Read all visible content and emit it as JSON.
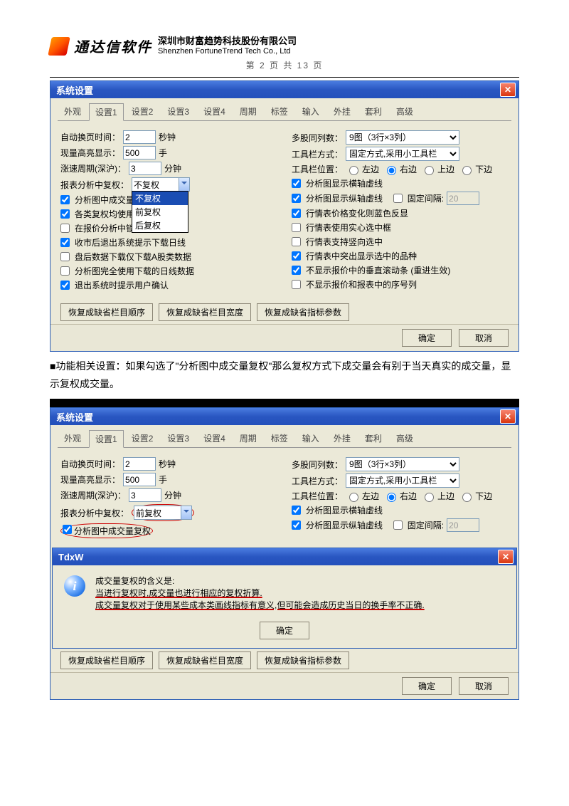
{
  "header": {
    "logo": "通达信软件",
    "company_cn": "深圳市财富趋势科技股份有限公司",
    "company_en": "Shenzhen FortuneTrend Tech Co., Ltd",
    "page_num": "第 2 页 共 13 页"
  },
  "win_title": "系统设置",
  "tabs": [
    "外观",
    "设置1",
    "设置2",
    "设置3",
    "设置4",
    "周期",
    "标签",
    "输入",
    "外挂",
    "套利",
    "高级"
  ],
  "active_tab": "设置1",
  "left": {
    "auto_page_label": "自动换页时间：",
    "auto_page_val": "2",
    "auto_page_unit": "秒钟",
    "highlight_label": "现量高亮显示：",
    "highlight_val": "500",
    "highlight_unit": "手",
    "speed_label": "涨速周期(深沪)：",
    "speed_val": "3",
    "speed_unit": "分钟",
    "report_label": "报表分析中复权：",
    "report_val": "不复权",
    "report_options": [
      "不复权",
      "前复权",
      "后复权"
    ],
    "cb1": "分析图中成交量",
    "cb2": "各类复权均使用",
    "cb3": "在报价分析中锁定排序状态",
    "cb4": "收市后退出系统提示下载日线",
    "cb5": "盘后数据下载仅下载A股类数据",
    "cb6": "分析图完全使用下载的日线数据",
    "cb7": "退出系统时提示用户确认"
  },
  "right": {
    "multi_label": "多股同列数：",
    "multi_val": "9图（3行×3列）",
    "toolbar_label": "工具栏方式：",
    "toolbar_val": "固定方式,采用小工具栏",
    "pos_label": "工具栏位置：",
    "pos_opts": [
      "左边",
      "右边",
      "上边",
      "下边"
    ],
    "pos_sel": "右边",
    "cb1": "分析图显示横轴虚线",
    "cb2": "分析图显示纵轴虚线",
    "fixed_gap": "固定间隔:",
    "fixed_gap_val": "20",
    "cb3": "行情表价格变化则蓝色反显",
    "cb4": "行情表使用实心选中框",
    "cb5": "行情表支持竖向选中",
    "cb6": "行情表中突出显示选中的品种",
    "cb7": "不显示报价中的垂直滚动条 (重进生效)",
    "cb8": "不显示报价和报表中的序号列"
  },
  "buttons": {
    "r1": "恢复成缺省栏目顺序",
    "r2": "恢复成缺省栏目宽度",
    "r3": "恢复成缺省指标参数",
    "ok": "确定",
    "cancel": "取消"
  },
  "body_text": "■功能相关设置：如果勾选了\"分析图中成交量复权\"那么复权方式下成交量会有别于当天真实的成交量，显示复权成交量。",
  "win2": {
    "report_val": "前复权",
    "cb1": "分析图中成交量复权"
  },
  "msg": {
    "title": "TdxW",
    "l1": "成交量复权的含义是:",
    "l2": "当进行复权时,成交量也进行相应的复权折算.",
    "l3": "成交量复权对于使用某些成本类画线指标有意义,但可能会造成历史当日的换手率不正确."
  }
}
